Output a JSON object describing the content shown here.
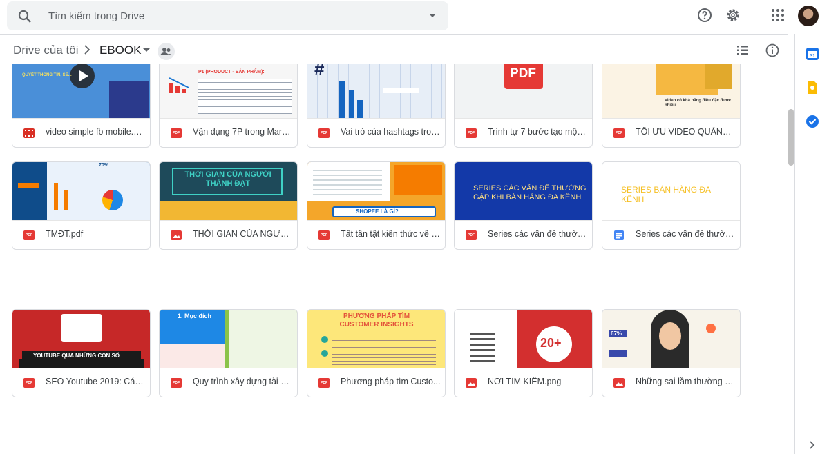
{
  "search": {
    "placeholder": "Tìm kiếm trong Drive"
  },
  "breadcrumb": {
    "root": "Drive của tôi",
    "current": "EBOOK"
  },
  "files": [
    {
      "name": "video simple fb mobile.m...",
      "type": "video",
      "thumb_text": "QUYẾT THÔNG TIN, SẼ..."
    },
    {
      "name": "Vận dụng 7P trong Marke...",
      "type": "pdf",
      "thumb_text": "P1 (PRODUCT - SẢN PHẨM):"
    },
    {
      "name": "Vai trò của hashtags tron...",
      "type": "pdf",
      "thumb_text": "#"
    },
    {
      "name": "Trình tự 7 bước tạo một b...",
      "type": "pdf",
      "thumb_text": "PDF"
    },
    {
      "name": "TỐI ƯU VIDEO QUẢNG C...",
      "type": "pdf",
      "thumb_text": "Video có khả năng điều đặc được nhiều"
    },
    {
      "name": "TMĐT.pdf",
      "type": "pdf",
      "thumb_text": "70%"
    },
    {
      "name": "THỜI GIAN CỦA NGƯỜI T...",
      "type": "image",
      "thumb_text": "THỜI GIAN CỦA NGƯỜI THÀNH ĐẠT"
    },
    {
      "name": "Tất tần tật kiến thức về ki...",
      "type": "pdf",
      "thumb_text": "SHOPEE LÀ GÌ?"
    },
    {
      "name": "Series các vấn đề thường...",
      "type": "pdf",
      "thumb_text": "SERIES CÁC VẤN ĐỀ THƯỜNG GẶP KHI BÁN HÀNG ĐA KÊNH"
    },
    {
      "name": "Series các vấn đề thường...",
      "type": "doc",
      "thumb_text": "SERIES BÁN HÀNG ĐA KÊNH"
    },
    {
      "name": "SEO Youtube 2019: Cách ...",
      "type": "pdf",
      "thumb_text": "YOUTUBE QUA NHỮNG CON SỐ"
    },
    {
      "name": "Quy trình xây dựng tài kh...",
      "type": "pdf",
      "thumb_text": "1. Mục đích"
    },
    {
      "name": "Phương pháp tìm Custo...",
      "type": "pdf",
      "thumb_text": "PHƯƠNG PHÁP TÌM CUSTOMER INSIGHTS"
    },
    {
      "name": "NƠI TÌM KIẾM.png",
      "type": "image",
      "thumb_text": "20+"
    },
    {
      "name": "Những sai lầm thường m...",
      "type": "image",
      "thumb_text": "67%"
    }
  ],
  "colors": {
    "pdf": "#e53935",
    "image": "#e53935",
    "video": "#d93025",
    "doc": "#4285f4",
    "accent": "#1a73e8"
  }
}
